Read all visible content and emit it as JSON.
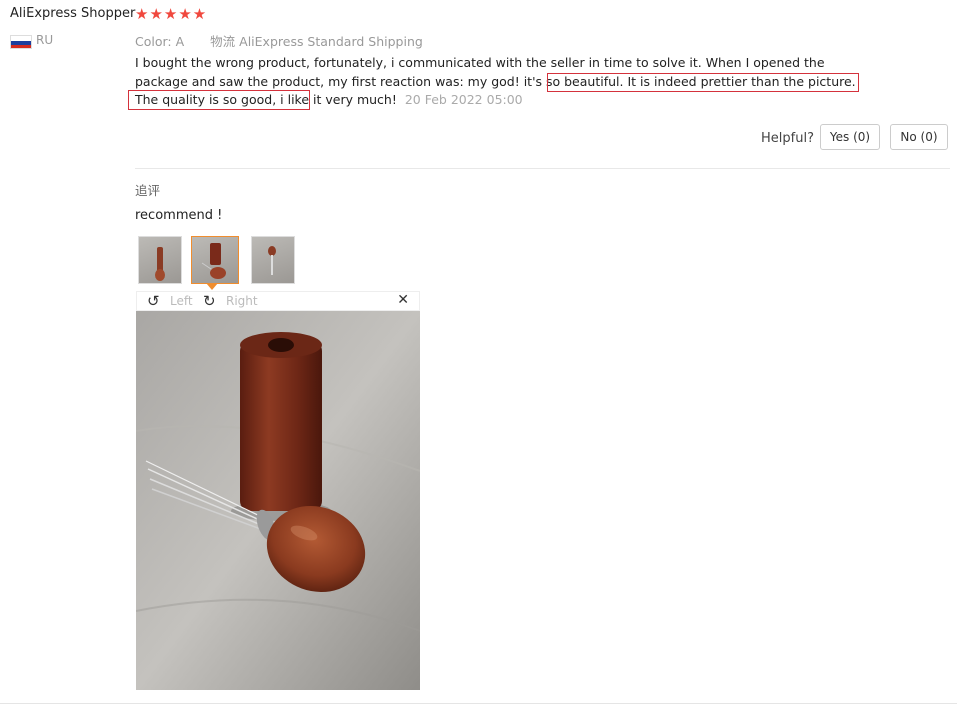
{
  "reviewer": {
    "name": "AliExpress Shopper",
    "stars": "★★★★★",
    "rating": 5,
    "country": "RU"
  },
  "attributes": {
    "color_label": "Color:",
    "color_value": "A",
    "shipping_label": "物流",
    "shipping_value": "AliExpress Standard Shipping"
  },
  "review": {
    "text": "I bought the wrong product, fortunately, i communicated with the seller in time to solve it. When I opened the package and saw the product, my first reaction was: my god! it's so beautiful. It is indeed prettier than the picture. The quality is so good, i like it very much! ",
    "date": "20 Feb 2022 05:00"
  },
  "helpful": {
    "label": "Helpful?",
    "yes_label": "Yes (0)",
    "no_label": "No (0)"
  },
  "followup": {
    "label": "追评",
    "text": "recommend !"
  },
  "viewer": {
    "left_label": "Left",
    "right_label": "Right",
    "selected_thumb": 2
  },
  "colors": {
    "star": "#f0483e",
    "highlight_box": "#d4323c",
    "selected_thumb": "#f08d2e"
  },
  "icons": [
    "star-icon",
    "russia-flag-icon",
    "rotate-left-icon",
    "rotate-right-icon",
    "close-icon"
  ]
}
